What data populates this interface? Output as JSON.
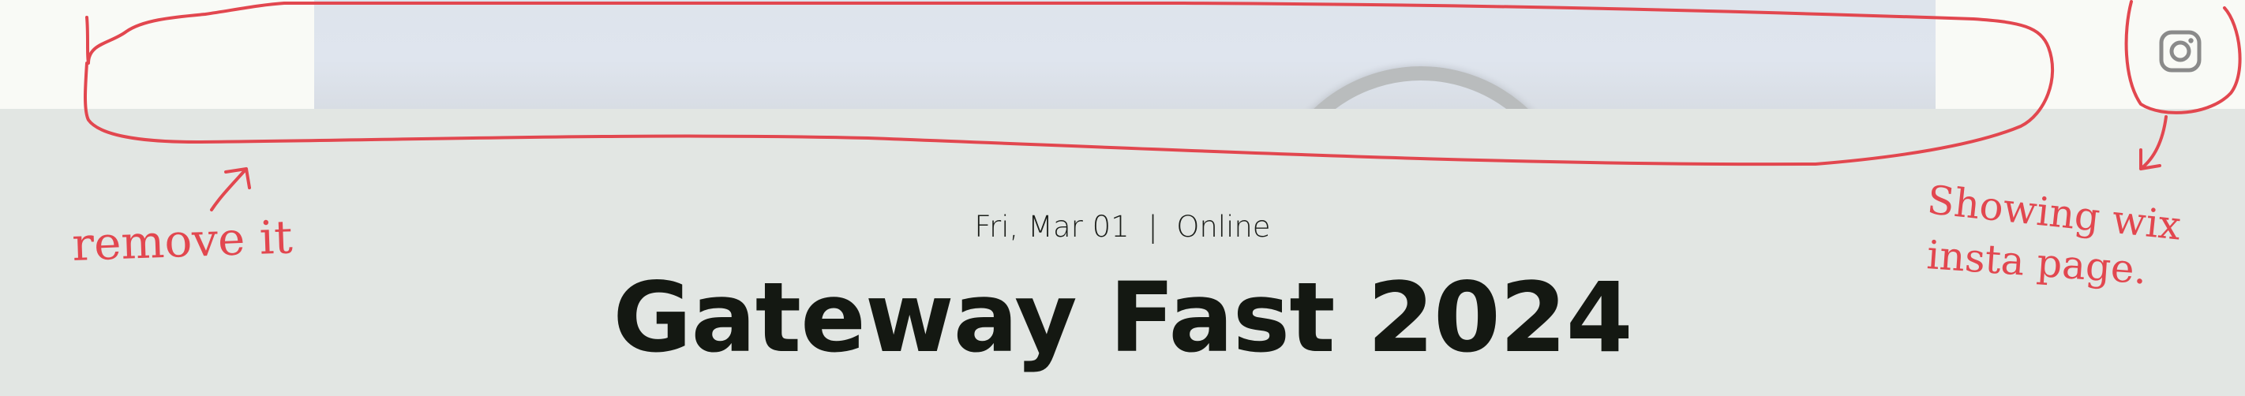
{
  "header": {
    "social_icon": "instagram-icon"
  },
  "event": {
    "date": "Fri, Mar 01",
    "separator": "|",
    "location": "Online",
    "title": "Gateway Fast 2024"
  },
  "annotations": {
    "remove_note": "remove it",
    "insta_note_line1": "Showing wix",
    "insta_note_line2": "insta page."
  },
  "colors": {
    "annotation": "#e2474f",
    "background": "#e2e6e3",
    "header_background": "#f9faf6",
    "title_text": "#141812",
    "icon": "#8a8a8a"
  }
}
